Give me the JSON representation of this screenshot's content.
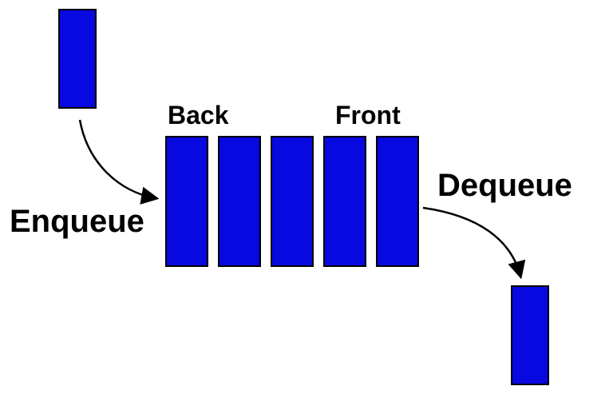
{
  "labels": {
    "back": "Back",
    "front": "Front",
    "enqueue": "Enqueue",
    "dequeue": "Dequeue"
  },
  "colors": {
    "block_fill": "#0808e0",
    "block_stroke": "#000000",
    "text": "#000000",
    "arrow": "#000000"
  },
  "queue": {
    "slot_count": 5,
    "orientation": "horizontal",
    "back_index": 0,
    "front_index": 4
  }
}
